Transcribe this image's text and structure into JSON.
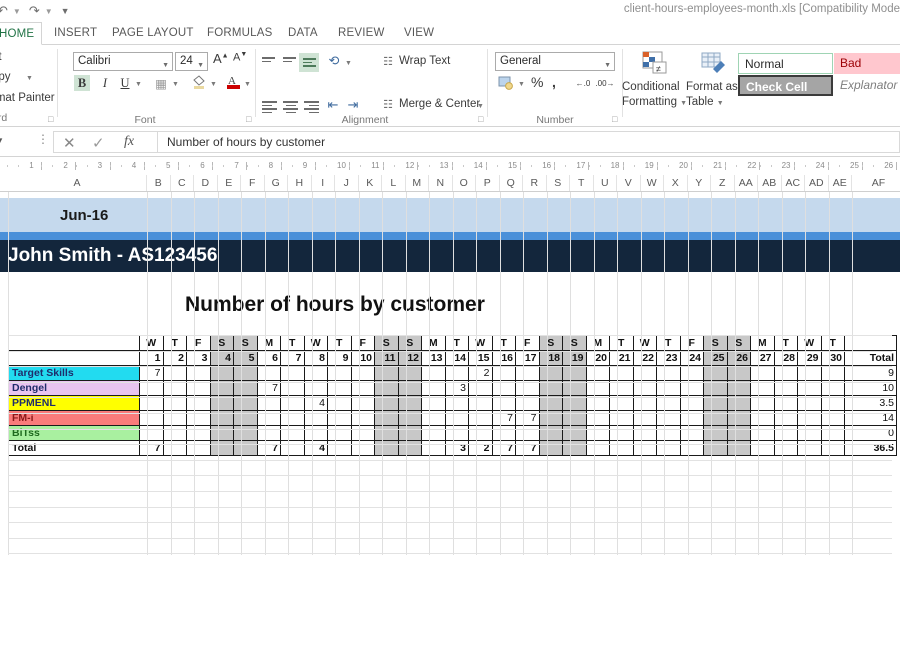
{
  "window": {
    "document_title": "client-hours-employees-month.xls  [Compatibility Mode"
  },
  "quick_access": {
    "undo_icon": "undo-icon",
    "redo_icon": "redo-icon",
    "customize_icon": "customize-quick-access-icon"
  },
  "ribbon": {
    "tabs": [
      {
        "label": "HOME",
        "active": true
      },
      {
        "label": "INSERT",
        "active": false
      },
      {
        "label": "PAGE LAYOUT",
        "active": false
      },
      {
        "label": "FORMULAS",
        "active": false
      },
      {
        "label": "DATA",
        "active": false
      },
      {
        "label": "REVIEW",
        "active": false
      },
      {
        "label": "VIEW",
        "active": false
      }
    ],
    "clipboard": {
      "group_label": "ard",
      "cut": "ut",
      "copy": "opy",
      "format_painter": "rmat Painter"
    },
    "font": {
      "group_label": "Font",
      "font_name": "Calibri",
      "font_size": "24",
      "grow_font": "A",
      "shrink_font": "A",
      "bold": "B",
      "italic": "I",
      "underline": "U"
    },
    "alignment": {
      "group_label": "Alignment",
      "wrap_text": "Wrap Text",
      "merge_center": "Merge & Center"
    },
    "number": {
      "group_label": "Number",
      "format": "General",
      "percent": "%",
      "comma": ",",
      "increase_decimal": ".00",
      "decrease_decimal": ".00"
    },
    "styles": {
      "conditional_formatting": "Conditional Formatting",
      "format_as_table": "Format as Table",
      "cell_styles": [
        {
          "label": "Normal",
          "kind": "normal"
        },
        {
          "label": "Bad",
          "kind": "bad"
        },
        {
          "label": "Check Cell",
          "kind": "check"
        },
        {
          "label": "Explanator",
          "kind": "explanatory"
        }
      ]
    }
  },
  "formula_bar": {
    "cancel_icon": "cancel-icon",
    "enter_icon": "confirm-icon",
    "function_icon": "insert-function-icon",
    "value": "Number of hours by customer"
  },
  "ruler": {
    "ticks": [
      "1",
      "2",
      "3",
      "4",
      "5",
      "6",
      "7",
      "8",
      "9",
      "10",
      "11",
      "12",
      "13",
      "14",
      "15",
      "16",
      "17",
      "18",
      "19",
      "20",
      "21",
      "22",
      "23",
      "24",
      "25",
      "26"
    ]
  },
  "grid": {
    "columns": [
      "A",
      "B",
      "C",
      "D",
      "E",
      "F",
      "G",
      "H",
      "I",
      "J",
      "K",
      "L",
      "M",
      "N",
      "O",
      "P",
      "Q",
      "R",
      "S",
      "T",
      "U",
      "V",
      "W",
      "X",
      "Y",
      "Z",
      "AA",
      "AB",
      "AC",
      "AD",
      "AE",
      "AF"
    ]
  },
  "sheet": {
    "month_label": "Jun-16",
    "employee_label": "John Smith -  AS123456",
    "title": "Number of hours by customer",
    "colors": {
      "month_band": "#c5d9ed",
      "accent_band": "#4a90d9",
      "name_band": "#13263c",
      "weekend_fill": "#c8c8c8"
    }
  },
  "chart_data": {
    "type": "table",
    "title": "Number of hours by customer",
    "corner_label": "",
    "total_header": "Total",
    "day_names": [
      "W",
      "T",
      "F",
      "S",
      "S",
      "M",
      "T",
      "W",
      "T",
      "F",
      "S",
      "S",
      "M",
      "T",
      "W",
      "T",
      "F",
      "S",
      "S",
      "M",
      "T",
      "W",
      "T",
      "F",
      "S",
      "S",
      "M",
      "T",
      "W",
      "T"
    ],
    "day_numbers": [
      1,
      2,
      3,
      4,
      5,
      6,
      7,
      8,
      9,
      10,
      11,
      12,
      13,
      14,
      15,
      16,
      17,
      18,
      19,
      20,
      21,
      22,
      23,
      24,
      25,
      26,
      27,
      28,
      29,
      30
    ],
    "weekend_days": [
      4,
      5,
      11,
      12,
      18,
      19,
      25,
      26
    ],
    "rows": [
      {
        "label": "Target Skills",
        "color": "#22dbf0",
        "text_color": "#1f2d6b",
        "values": [
          "7",
          "",
          "",
          "",
          "",
          "",
          "",
          "",
          "",
          "",
          "",
          "",
          "",
          "",
          "2",
          "",
          "",
          "",
          "",
          "",
          "",
          "",
          "",
          "",
          "",
          "",
          "",
          "",
          "",
          ""
        ],
        "total": "9"
      },
      {
        "label": "Dengel",
        "color": "#e8c4f0",
        "text_color": "#1f2d6b",
        "values": [
          "",
          "",
          "",
          "",
          "",
          "7",
          "",
          "",
          "",
          "",
          "",
          "",
          "",
          "3",
          "",
          "",
          "",
          "",
          "",
          "",
          "",
          "",
          "",
          "",
          "",
          "",
          "",
          "",
          "",
          ""
        ],
        "total": "10"
      },
      {
        "label": "PPMENL",
        "color": "#ffff00",
        "text_color": "#1f2d6b",
        "values": [
          "",
          "",
          "",
          "",
          "",
          "",
          "",
          "4",
          "",
          "",
          "",
          "",
          "",
          "",
          "",
          "",
          "",
          "",
          "",
          "",
          "",
          "",
          "",
          "",
          "",
          "",
          "",
          "",
          "",
          ""
        ],
        "total": "3.5"
      },
      {
        "label": "FM-i",
        "color": "#fa7b7b",
        "text_color": "#8a1a1a",
        "values": [
          "",
          "",
          "",
          "",
          "",
          "",
          "",
          "",
          "",
          "",
          "",
          "",
          "",
          "",
          "",
          "7",
          "7",
          "",
          "",
          "",
          "",
          "",
          "",
          "",
          "",
          "",
          "",
          "",
          "",
          ""
        ],
        "total": "14"
      },
      {
        "label": "BiTss",
        "color": "#a9f0a0",
        "text_color": "#1f6b1f",
        "values": [
          "",
          "",
          "",
          "",
          "",
          "",
          "",
          "",
          "",
          "",
          "",
          "",
          "",
          "",
          "",
          "",
          "",
          "",
          "",
          "",
          "",
          "",
          "",
          "",
          "",
          "",
          "",
          "",
          "",
          ""
        ],
        "total": "0"
      },
      {
        "label": "Total",
        "color": "#ffffff",
        "text_color": "#111111",
        "is_total": true,
        "values": [
          "7",
          "",
          "",
          "",
          "",
          "7",
          "",
          "4",
          "",
          "",
          "",
          "",
          "",
          "3",
          "2",
          "7",
          "7",
          "",
          "",
          "",
          "",
          "",
          "",
          "",
          "",
          "",
          "",
          "",
          "",
          ""
        ],
        "total": "36.5"
      }
    ]
  }
}
